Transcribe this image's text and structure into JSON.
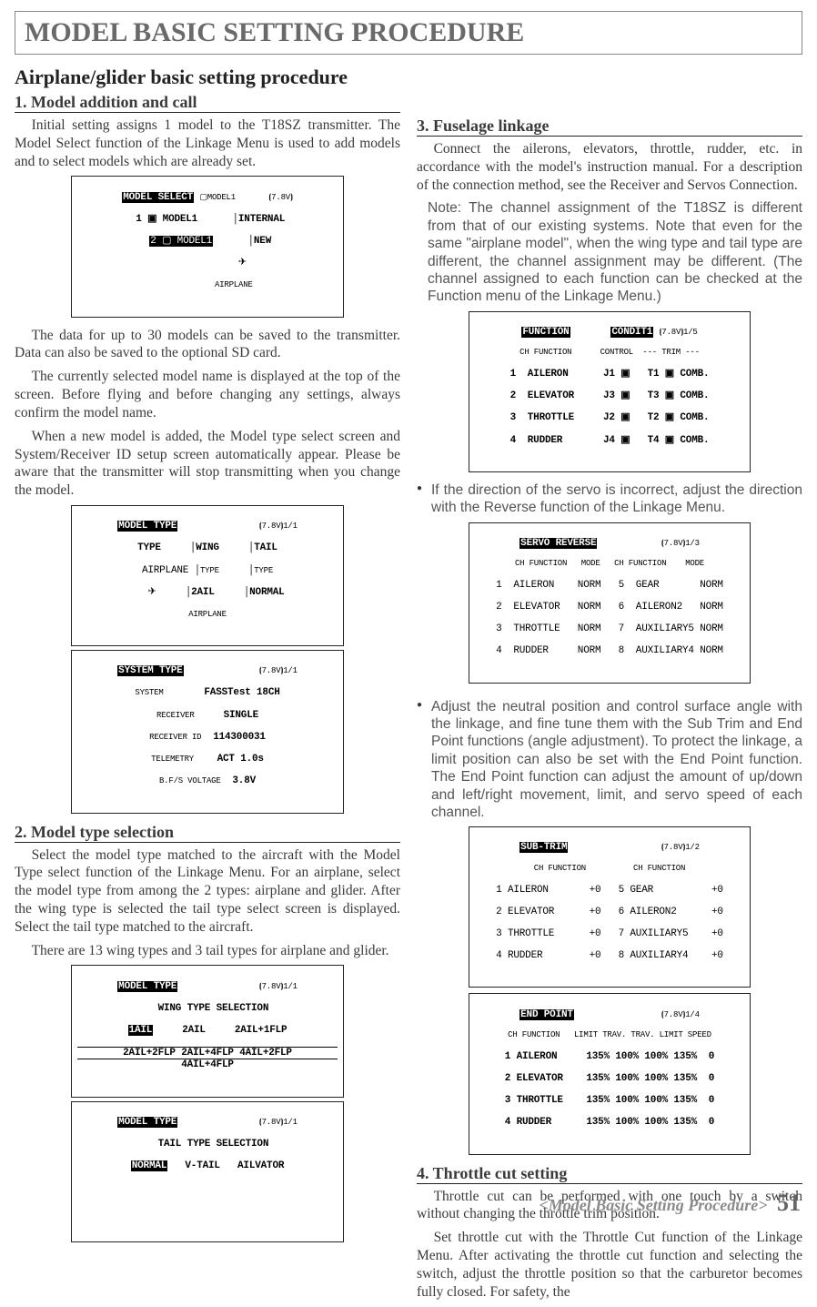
{
  "header": {
    "main_title": "MODEL BASIC SETTING PROCEDURE",
    "sub_title": "Airplane/glider basic setting procedure"
  },
  "left": {
    "s1_head": "1. Model addition and call",
    "s1_p1": "Initial setting assigns 1 model to the T18SZ transmitter. The Model Select function of the Linkage Menu is used to add models and to select models which are already set.",
    "s1_p2": "The data for up to 30 models can be saved to the transmitter. Data can also be saved to the optional SD card.",
    "s1_p3": "The currently selected model name is displayed at the top of the screen. Before flying and before changing any settings, always confirm the model name.",
    "s1_p4": "When a new model is added, the Model type select screen and System/Receiver ID setup screen automatically appear. Please be  aware that the transmitter will stop transmitting when you change the model.",
    "s2_head": "2. Model type selection",
    "s2_p1": "Select the model type matched to the aircraft with the Model Type select function of the Linkage Menu. For an airplane, select the model type from among the 2 types: airplane and glider. After the  wing type is selected the tail type select screen is displayed. Select the tail type matched to the aircraft.",
    "s2_p2": "There are 13 wing types and 3 tail types for airplane and glider."
  },
  "right": {
    "s3_head": "3. Fuselage linkage",
    "s3_p1": "Connect the ailerons, elevators, throttle, rudder, etc. in accordance with the model's instruction manual. For a description of the connection method, see the Receiver and Servos Connection.",
    "s3_note": "Note: The channel assignment of the T18SZ is different from that of our existing systems. Note that even for the same \"airplane model\", when the wing type and tail type are different, the channel assignment may be different. (The channel assigned to each function can be checked at the Function menu of the Linkage Menu.)",
    "s3_b1": "If the direction of the servo is incorrect, adjust the direction with the Reverse function of the Linkage Menu.",
    "s3_b2": "Adjust the neutral position and control surface angle with the linkage, and fine tune them with the Sub Trim and End Point functions (angle adjustment). To protect the linkage, a limit position can also be set with the End Point function. The End Point function can adjust the amount of up/down and left/right movement, limit, and servo speed of each channel.",
    "s4_head": "4. Throttle cut setting",
    "s4_p1": "Throttle cut can be performed with one touch by a switch without changing the throttle trim position.",
    "s4_p2": "Set throttle cut with the Throttle Cut function of the Linkage Menu. After activating the throttle cut function and selecting the switch, adjust the throttle position so that the carburetor becomes fully closed. For safety, the"
  },
  "lcd": {
    "model_select": {
      "title": "MODEL SELECT",
      "header_right": "▢MODEL1       ⦗7.8V⦘",
      "r1_left": "1 ▣ MODEL1",
      "r1_right": "INTERNAL",
      "r2_left": "2 ▢ MODEL1",
      "r2_right": "NEW",
      "icon": "✈",
      "icon_label": "AIRPLANE"
    },
    "model_type": {
      "title": "MODEL TYPE",
      "tr": "⦗7.8V⦘1/1",
      "c1h": "TYPE",
      "c2h": "WING",
      "c3h": "TAIL",
      "c1v": "AIRPLANE",
      "c2l": "TYPE",
      "c2v": "2AIL",
      "c3l": "TYPE",
      "c3v": "NORMAL",
      "icon": "✈",
      "icon_label": "AIRPLANE"
    },
    "system_type": {
      "title": "SYSTEM TYPE",
      "tr": "⦗7.8V⦘1/1",
      "r1l": "SYSTEM",
      "r1v": "FASSTest 18CH",
      "r2l": "RECEIVER",
      "r2v": "SINGLE",
      "r3l": "RECEIVER ID",
      "r3v": "114300031",
      "r4l": "TELEMETRY",
      "r4v": "ACT 1.0s",
      "r5l": "B.F/S VOLTAGE",
      "r5v": "3.8V"
    },
    "wing_sel": {
      "title": "MODEL TYPE",
      "tr": "⦗7.8V⦘1/1",
      "sub": "WING TYPE SELECTION",
      "r1a": "1AIL",
      "r1b": "2AIL",
      "r1c": "2AIL+1FLP",
      "r2a": "2AIL+2FLP",
      "r2b": "2AIL+4FLP",
      "r2c": "4AIL+2FLP",
      "r3a": "4AIL+4FLP"
    },
    "tail_sel": {
      "title": "MODEL TYPE",
      "tr": "⦗7.8V⦘1/1",
      "sub": "TAIL TYPE SELECTION",
      "r1a": "NORMAL",
      "r1b": "V-TAIL",
      "r1c": "AILVATOR"
    },
    "function": {
      "title": "FUNCTION",
      "cond": "CONDIT1",
      "tr": "⦗7.8V⦘1/5",
      "hr": "CH FUNCTION      CONTROL  --- TRIM ---",
      "r1": "1  AILERON      J1 ▣   T1 ▣ COMB.",
      "r2": "2  ELEVATOR     J3 ▣   T3 ▣ COMB.",
      "r3": "3  THROTTLE     J2 ▣   T2 ▣ COMB.",
      "r4": "4  RUDDER       J4 ▣   T4 ▣ COMB."
    },
    "servo_rev": {
      "title": "SERVO REVERSE",
      "tr": "⦗7.8V⦘1/3",
      "hr": "CH FUNCTION   MODE   CH FUNCTION    MODE",
      "r1": "1  AILERON    NORM   5  GEAR       NORM",
      "r2": "2  ELEVATOR   NORM   6  AILERON2   NORM",
      "r3": "3  THROTTLE   NORM   7  AUXILIARY5 NORM",
      "r4": "4  RUDDER     NORM   8  AUXILIARY4 NORM"
    },
    "sub_trim": {
      "title": "SUB-TRIM",
      "tr": "⦗7.8V⦘1/2",
      "hr": "CH FUNCTION          CH FUNCTION",
      "r1": "1 AILERON       +0   5 GEAR          +0",
      "r2": "2 ELEVATOR      +0   6 AILERON2      +0",
      "r3": "3 THROTTLE      +0   7 AUXILIARY5    +0",
      "r4": "4 RUDDER        +0   8 AUXILIARY4    +0"
    },
    "end_point": {
      "title": "END POINT",
      "tr": "⦗7.8V⦘1/4",
      "hr": "CH FUNCTION   LIMIT TRAV. TRAV. LIMIT SPEED",
      "r1": "1 AILERON     135% 100% 100% 135%  0",
      "r2": "2 ELEVATOR    135% 100% 100% 135%  0",
      "r3": "3 THROTTLE    135% 100% 100% 135%  0",
      "r4": "4 RUDDER      135% 100% 100% 135%  0"
    }
  },
  "footer": {
    "label": "<Model Basic Setting Procedure>",
    "page": "51"
  }
}
